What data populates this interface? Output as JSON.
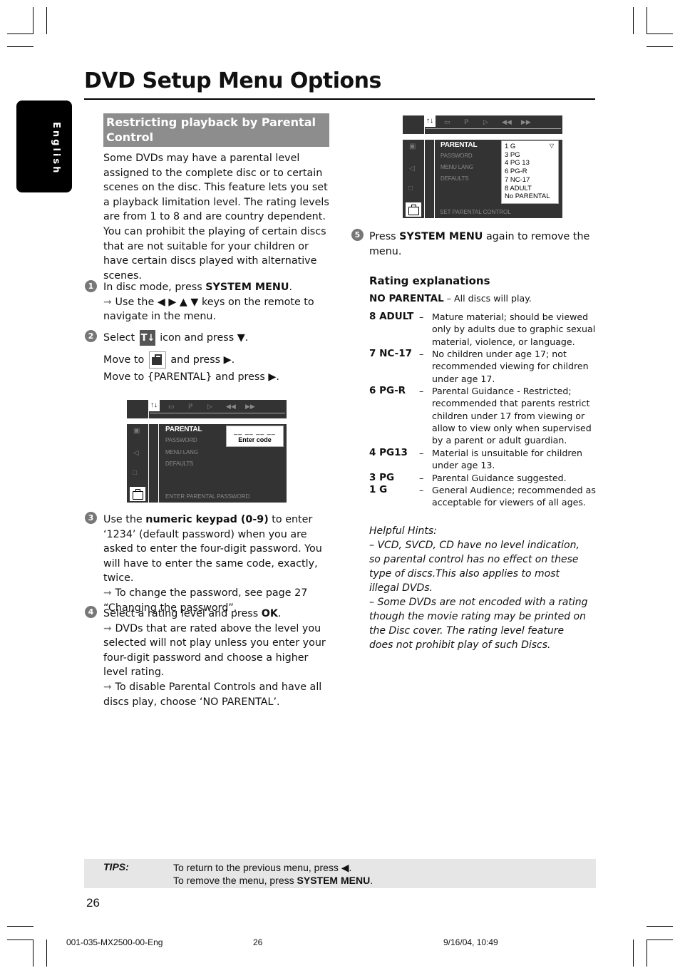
{
  "page": {
    "title": "DVD Setup Menu Options",
    "language_tab": "English",
    "page_number": "26"
  },
  "section": {
    "heading": "Restricting playback by Parental Control",
    "intro": "Some DVDs may have a parental level assigned to the complete disc or to certain scenes on the disc. This feature lets you set a playback limitation level. The rating levels are from 1 to 8 and are country dependent. You can prohibit the playing of certain discs that are not suitable for your children or have certain discs played with alternative scenes."
  },
  "steps": [
    {
      "number": "1",
      "pre": "In disc mode, press ",
      "bold": "SYSTEM MENU",
      "post": ".",
      "note": "Use the ◀ ▶ ▲ ▼ keys on the remote to navigate in the menu."
    },
    {
      "number": "2",
      "line1_pre": "Select",
      "line1_post": "icon and press ▼.",
      "line2_pre": "Move to",
      "line2_post": "and press ▶.",
      "line3": "Move to {PARENTAL} and press ▶."
    },
    {
      "number": "3",
      "pre": "Use the ",
      "bold": "numeric keypad (0-9)",
      "post": " to enter ‘1234’ (default password) when you are asked to enter the four-digit password. You will have to enter the same code, exactly, twice.",
      "note": "To change the password, see page 27 “Changing the password”."
    },
    {
      "number": "4",
      "pre": "Select a rating level and press ",
      "bold": "OK",
      "post": ".",
      "note1": "DVDs that are rated above the level you selected will not play unless you enter your four-digit password and choose a higher level rating.",
      "note2": "To disable Parental Controls and have all discs play, choose ‘NO PARENTAL’."
    },
    {
      "number": "5",
      "pre": "Press ",
      "bold": "SYSTEM MENU",
      "post": " again to remove the menu."
    }
  ],
  "osd_password": {
    "tools_icon": "↑↓",
    "top_icons": [
      "display-icon",
      "audio-icon",
      "play-icon",
      "rewind-icon",
      "forward-icon"
    ],
    "menu_items": [
      "PARENTAL",
      "PASSWORD",
      "MENU LANG",
      "DEFAULTS"
    ],
    "popup_dashes": "__  __  __  __",
    "popup_label": "Enter code",
    "status": "ENTER PARENTAL PASSWORD"
  },
  "osd_rating": {
    "tools_icon": "↑↓",
    "menu_items": [
      "PARENTAL",
      "PASSWORD",
      "MENU LANG",
      "DEFAULTS"
    ],
    "options": [
      "1 G",
      "3 PG",
      "4 PG 13",
      "6 PG-R",
      "7 NC-17",
      "8 ADULT",
      "No PARENTAL"
    ],
    "selected": "1 G",
    "status": "SET PARENTAL CONTROL"
  },
  "ratings": {
    "heading": "Rating explanations",
    "no_parental_label": "NO PARENTAL",
    "no_parental_desc": "– All discs will play.",
    "dash": "–",
    "items": [
      {
        "label": "8 ADULT",
        "desc": "Mature material; should be viewed only by adults due to graphic sexual material, violence, or language."
      },
      {
        "label": "7 NC-17",
        "desc": "No children under age 17; not recommended viewing for children under age 17."
      },
      {
        "label": "6 PG-R",
        "desc": "Parental Guidance - Restricted; recommended that parents restrict children under 17 from viewing or allow to view only when supervised by a parent or adult guardian."
      },
      {
        "label": "4 PG13",
        "desc": "Material is unsuitable for children under age 13."
      },
      {
        "label": "3 PG",
        "desc": "Parental Guidance suggested."
      },
      {
        "label": "1 G",
        "desc": "General Audience; recommended as acceptable for viewers of all ages."
      }
    ]
  },
  "hints": {
    "title": "Helpful Hints:",
    "items": [
      "–  VCD, SVCD, CD have no level indication, so parental control has no effect on these type of discs.This also applies to most illegal DVDs.",
      "–  Some DVDs are not encoded with a rating though the movie rating may be printed on the Disc cover. The rating level feature does not prohibit play of such Discs."
    ]
  },
  "tips": {
    "label": "TIPS:",
    "line1": "To return to the previous menu, press ◀.",
    "line2_pre": "To remove the menu, press ",
    "line2_bold": "SYSTEM MENU",
    "line2_post": "."
  },
  "footer": {
    "doc_id": "001-035-MX2500-00-Eng",
    "page": "26",
    "timestamp": "9/16/04, 10:49"
  }
}
